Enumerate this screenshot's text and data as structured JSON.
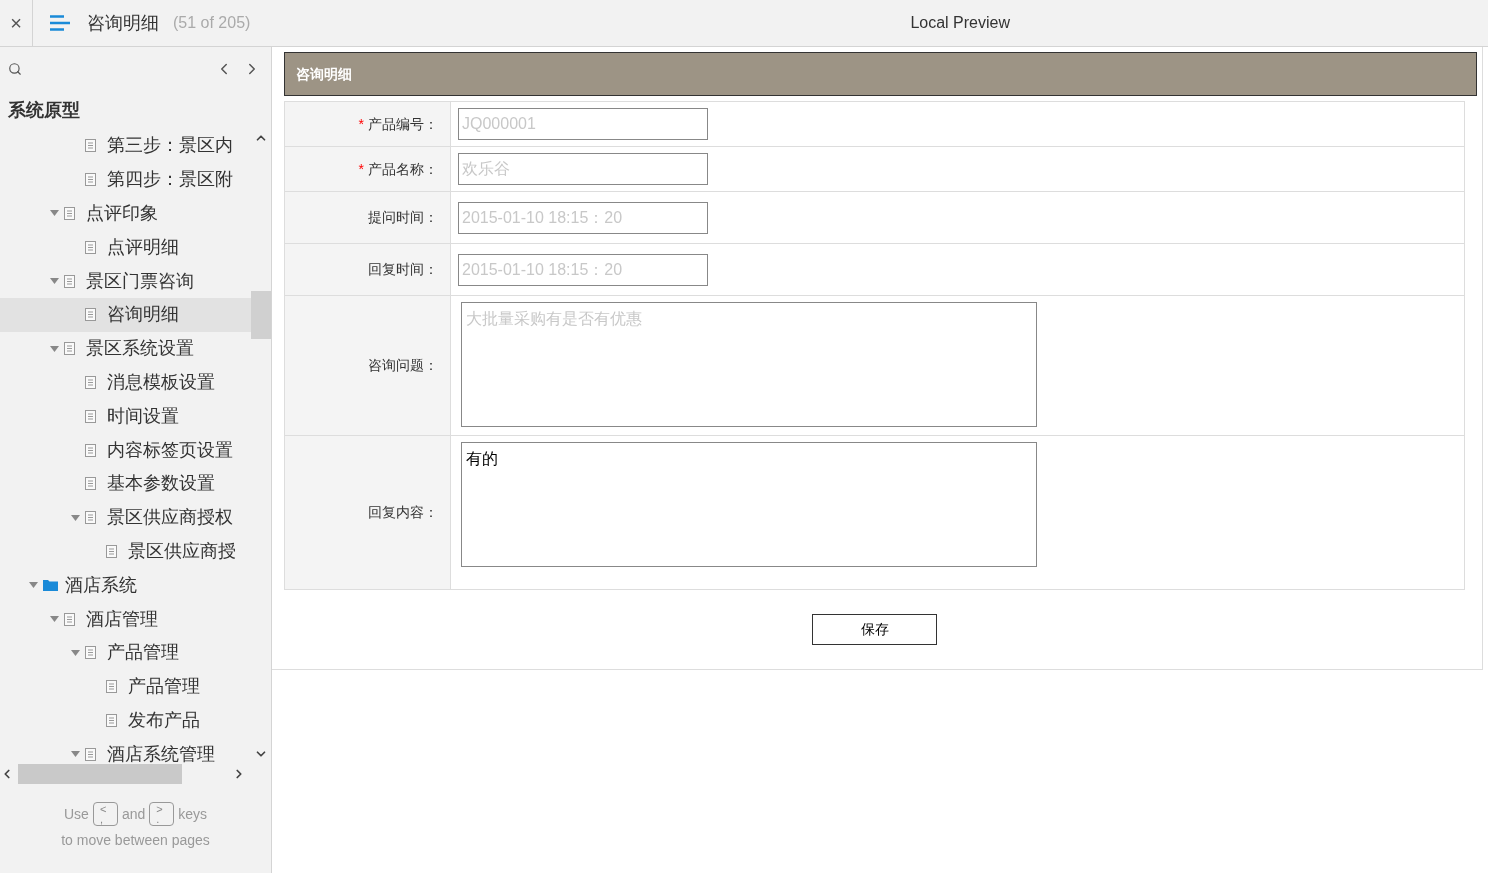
{
  "topbar": {
    "close": "×",
    "page_title": "咨询明细",
    "page_count": "(51 of 205)",
    "preview_title": "Local Preview"
  },
  "sidebar": {
    "project_title": "系统原型",
    "tree": [
      {
        "kind": "hidden",
        "children": [
          {
            "kind": "hidden",
            "children": [
              {
                "kind": "page",
                "label": "第三步：景区内",
                "selected": false
              },
              {
                "kind": "page",
                "label": "第四步：景区附",
                "selected": false
              }
            ]
          },
          {
            "kind": "page",
            "label": "点评印象",
            "selected": false,
            "expanded": true,
            "children": [
              {
                "kind": "page",
                "label": "点评明细",
                "selected": false
              }
            ]
          },
          {
            "kind": "page",
            "label": "景区门票咨询",
            "selected": false,
            "expanded": true,
            "children": [
              {
                "kind": "page",
                "label": "咨询明细",
                "selected": true
              }
            ]
          },
          {
            "kind": "page",
            "label": "景区系统设置",
            "selected": false,
            "expanded": true,
            "children": [
              {
                "kind": "page",
                "label": "消息模板设置",
                "selected": false
              },
              {
                "kind": "page",
                "label": "时间设置",
                "selected": false
              },
              {
                "kind": "page",
                "label": "内容标签页设置",
                "selected": false
              },
              {
                "kind": "page",
                "label": "基本参数设置",
                "selected": false
              },
              {
                "kind": "page",
                "label": "景区供应商授权",
                "selected": false,
                "expanded": true,
                "children": [
                  {
                    "kind": "page",
                    "label": "景区供应商授",
                    "selected": false
                  }
                ]
              }
            ]
          }
        ]
      },
      {
        "kind": "folder",
        "label": "酒店系统",
        "selected": false,
        "expanded": true,
        "children": [
          {
            "kind": "page",
            "label": "酒店管理",
            "selected": false,
            "expanded": true,
            "children": [
              {
                "kind": "page",
                "label": "产品管理",
                "selected": false,
                "expanded": true,
                "children": [
                  {
                    "kind": "page",
                    "label": "产品管理",
                    "selected": false
                  },
                  {
                    "kind": "page",
                    "label": "发布产品",
                    "selected": false
                  }
                ]
              },
              {
                "kind": "page",
                "label": "酒店系统管理",
                "selected": false,
                "expanded": true
              }
            ]
          }
        ]
      }
    ],
    "hint": {
      "use": "Use",
      "key_prev_top": "<",
      "key_prev_bottom": ",",
      "and": "and",
      "key_next_top": ">",
      "key_next_bottom": ".",
      "keys": "keys",
      "line2": "to move between pages"
    }
  },
  "form": {
    "title": "咨询明细",
    "required_mark": "*",
    "rows": [
      {
        "kind": "input",
        "label": "产品编号：",
        "required": true,
        "placeholder": "JQ000001"
      },
      {
        "kind": "input",
        "label": "产品名称：",
        "required": true,
        "placeholder": "欢乐谷"
      },
      {
        "kind": "input",
        "label": "提问时间：",
        "required": false,
        "placeholder": "2015-01-10 18:15：20"
      },
      {
        "kind": "input",
        "label": "回复时间：",
        "required": false,
        "placeholder": "2015-01-10 18:15：20"
      },
      {
        "kind": "textarea",
        "label": "咨询问题：",
        "required": false,
        "placeholder": "大批量采购有是否有优惠"
      },
      {
        "kind": "textarea",
        "label": "回复内容：",
        "required": false,
        "value": "有的"
      }
    ],
    "save_button": "保存"
  }
}
